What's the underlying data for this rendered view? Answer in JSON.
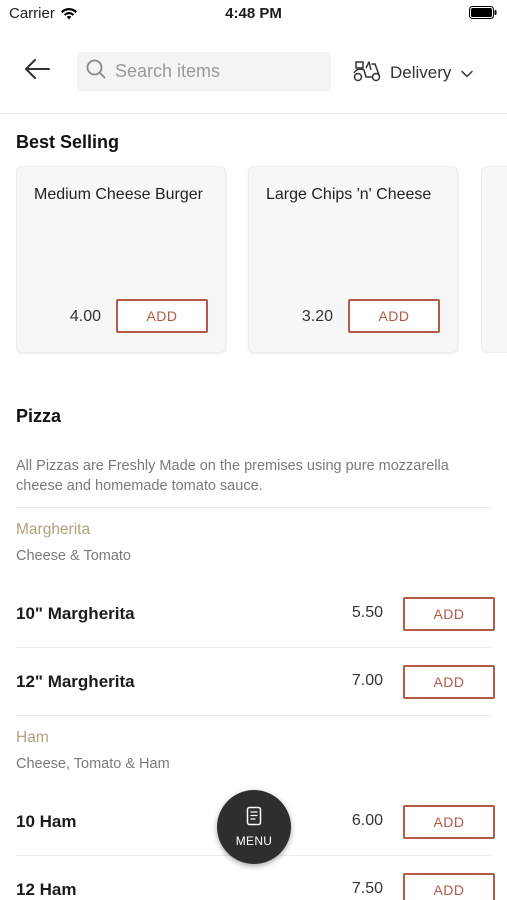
{
  "status_bar": {
    "carrier": "Carrier",
    "time": "4:48 PM"
  },
  "header": {
    "search": {
      "placeholder": "Search items",
      "value": ""
    },
    "delivery_label": "Delivery"
  },
  "best_selling": {
    "title": "Best Selling",
    "cards": [
      {
        "name": "Medium Cheese Burger",
        "price": "4.00",
        "add_label": "ADD"
      },
      {
        "name": "Large Chips 'n' Cheese",
        "price": "3.20",
        "add_label": "ADD"
      }
    ]
  },
  "pizza": {
    "title": "Pizza",
    "description": "All Pizzas are Freshly Made on the premises using pure mozzarella cheese and homemade tomato sauce.",
    "groups": [
      {
        "title": "Margherita",
        "description": "Cheese & Tomato",
        "items": [
          {
            "name": "10\" Margherita",
            "price": "5.50",
            "add_label": "ADD"
          },
          {
            "name": "12\" Margherita",
            "price": "7.00",
            "add_label": "ADD"
          }
        ]
      },
      {
        "title": "Ham",
        "description": "Cheese, Tomato & Ham",
        "items": [
          {
            "name": "10 Ham",
            "price": "6.00",
            "add_label": "ADD"
          },
          {
            "name": "12 Ham",
            "price": "7.50",
            "add_label": "ADD"
          }
        ]
      }
    ]
  },
  "menu_button": {
    "label": "MENU"
  },
  "colors": {
    "accent": "#b35a45",
    "group_title": "#b0a27f",
    "fab": "#2e2e2e"
  }
}
